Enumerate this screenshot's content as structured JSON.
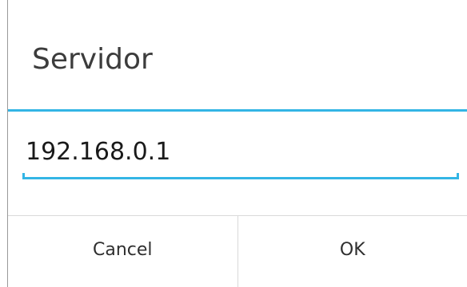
{
  "dialog": {
    "title": "Servidor",
    "input": {
      "value": "192.168.0.1"
    },
    "buttons": {
      "cancel_label": "Cancel",
      "ok_label": "OK"
    }
  },
  "colors": {
    "accent": "#33b5e5",
    "text": "#3c3c3c",
    "divider": "#d9d9d9"
  }
}
